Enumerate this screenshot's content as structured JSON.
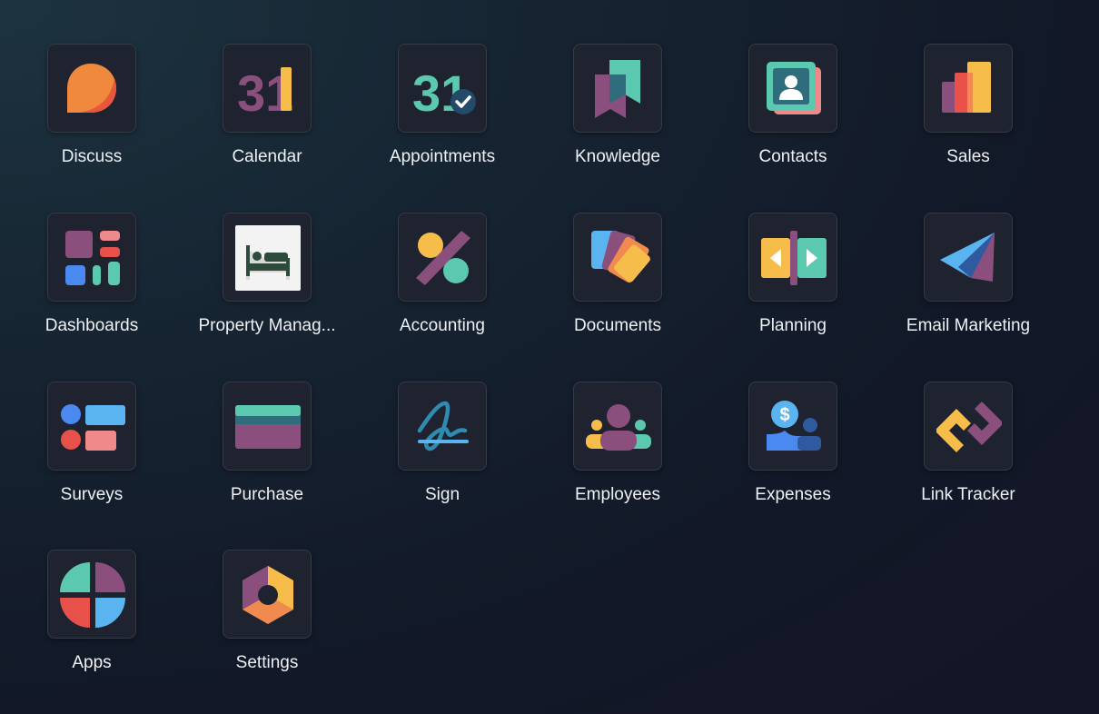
{
  "apps": [
    {
      "label": "Discuss",
      "icon": "discuss-icon"
    },
    {
      "label": "Calendar",
      "icon": "calendar-icon",
      "number": "31"
    },
    {
      "label": "Appointments",
      "icon": "appointments-icon",
      "number": "31"
    },
    {
      "label": "Knowledge",
      "icon": "knowledge-icon"
    },
    {
      "label": "Contacts",
      "icon": "contacts-icon"
    },
    {
      "label": "Sales",
      "icon": "sales-icon"
    },
    {
      "label": "Dashboards",
      "icon": "dashboards-icon"
    },
    {
      "label": "Property Manag...",
      "icon": "property-management-icon"
    },
    {
      "label": "Accounting",
      "icon": "accounting-icon"
    },
    {
      "label": "Documents",
      "icon": "documents-icon"
    },
    {
      "label": "Planning",
      "icon": "planning-icon"
    },
    {
      "label": "Email Marketing",
      "icon": "email-marketing-icon"
    },
    {
      "label": "Surveys",
      "icon": "surveys-icon"
    },
    {
      "label": "Purchase",
      "icon": "purchase-icon"
    },
    {
      "label": "Sign",
      "icon": "sign-icon"
    },
    {
      "label": "Employees",
      "icon": "employees-icon"
    },
    {
      "label": "Expenses",
      "icon": "expenses-icon",
      "symbol": "$"
    },
    {
      "label": "Link Tracker",
      "icon": "link-tracker-icon"
    },
    {
      "label": "Apps",
      "icon": "apps-icon"
    },
    {
      "label": "Settings",
      "icon": "settings-icon"
    }
  ],
  "colors": {
    "background": "#141a27",
    "tile": "#1f232f",
    "tile_border": "#343a48",
    "label": "#eef0f4",
    "orange": "#f0883e",
    "purple": "#8a4f7d",
    "yellow": "#f6bd4a",
    "teal": "#5bc8b0",
    "blue": "#5ab4f0",
    "coral": "#f08a8a",
    "red": "#e8504a"
  }
}
